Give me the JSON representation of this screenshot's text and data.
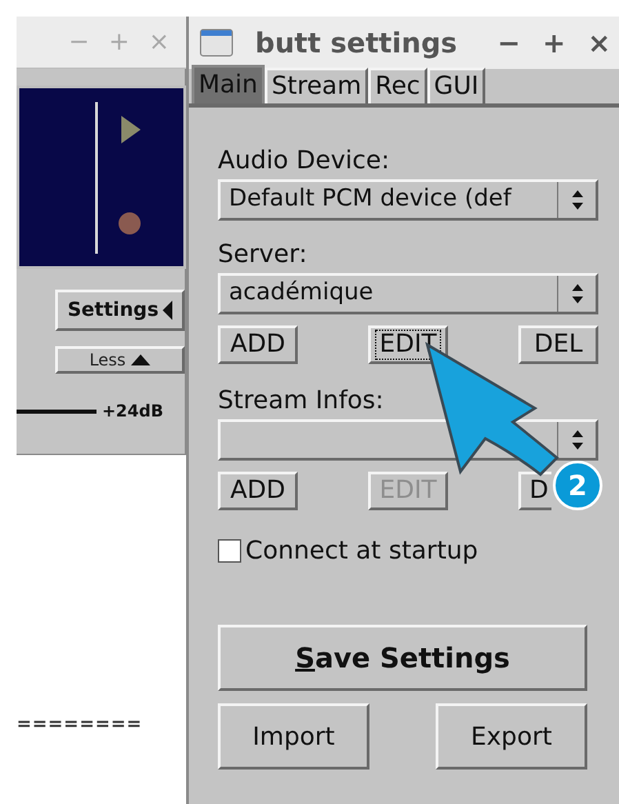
{
  "left_window": {
    "window_controls": [
      "−",
      "+",
      "×"
    ],
    "settings_button": "Settings",
    "less_button": "Less",
    "gain_reading": "+24dB",
    "separator_text": "========"
  },
  "settings_window": {
    "title": "butt settings",
    "window_controls": [
      "−",
      "+",
      "×"
    ],
    "tabs": [
      {
        "label": "Main",
        "selected": true
      },
      {
        "label": "Stream",
        "selected": false
      },
      {
        "label": "Rec",
        "selected": false
      },
      {
        "label": "GUI",
        "selected": false
      }
    ],
    "audio_device": {
      "label": "Audio Device:",
      "value": "Default PCM device (def"
    },
    "server": {
      "label": "Server:",
      "value": "académique",
      "buttons": [
        {
          "label": "ADD",
          "disabled": false,
          "focused": false
        },
        {
          "label": "EDIT",
          "disabled": false,
          "focused": true
        },
        {
          "label": "DEL",
          "disabled": false,
          "focused": false
        }
      ]
    },
    "stream_infos": {
      "label": "Stream Infos:",
      "buttons": [
        {
          "label": "ADD",
          "disabled": false,
          "focused": false
        },
        {
          "label": "EDIT",
          "disabled": true,
          "focused": false
        },
        {
          "label": "D",
          "disabled": false,
          "focused": false
        }
      ]
    },
    "connect_at_startup": {
      "label": "Connect at startup",
      "checked": false
    },
    "save_button": {
      "label": "Save Settings",
      "first_letter_underlined": true
    },
    "import_button": "Import",
    "export_button": "Export"
  },
  "annotation": {
    "badge": "2"
  }
}
